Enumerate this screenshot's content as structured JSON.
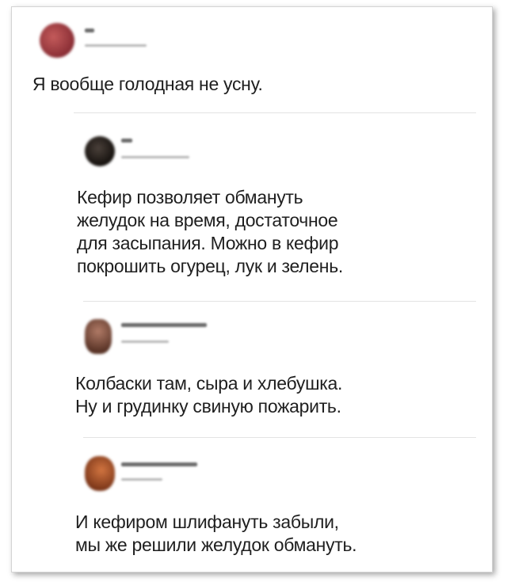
{
  "thread": {
    "post": {
      "avatar_color": "#9c3b3b",
      "text": "Я вообще голодная не усну."
    },
    "replies": [
      {
        "avatar_color": "#2b2622",
        "text": "Кефир позволяет обмануть\nжелудок на время, достаточное\nдля засыпания. Можно в кефир\nпокрошить огурец, лук и зелень."
      },
      {
        "avatar_color": "#8a5a4a",
        "text": "Колбаски там, сыра и хлебушка.\nНу и грудинку свиную пожарить."
      },
      {
        "avatar_color": "#b5562e",
        "text": "И кефиром шлифануть забыли,\nмы же решили желудок обмануть."
      }
    ]
  }
}
